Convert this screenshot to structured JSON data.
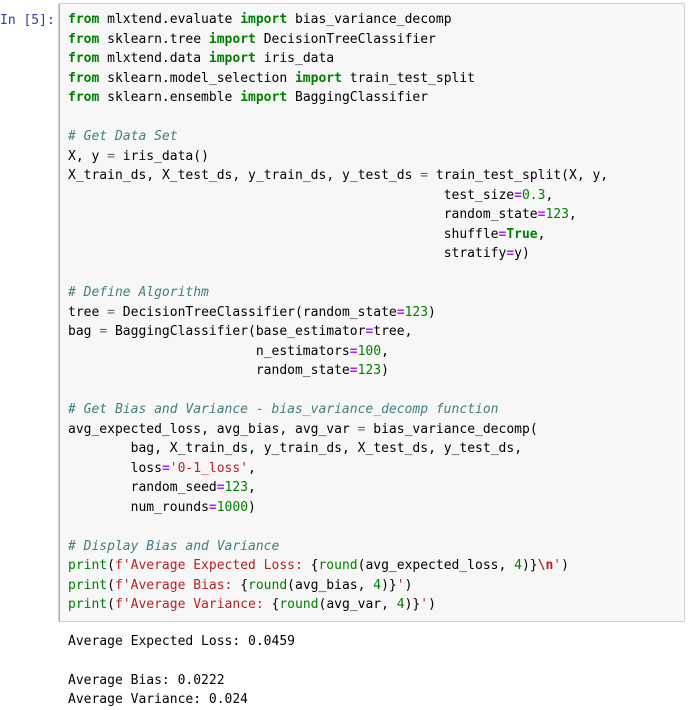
{
  "cell": {
    "prompt_label": "In [5]:",
    "language": "python",
    "colors": {
      "keyword": "#008000",
      "comment": "#408080",
      "string": "#ba2121",
      "number": "#008000",
      "operator": "#666666",
      "kwarg_equals": "#aa22ff",
      "prompt": "#303f9f",
      "code_background": "#f7f7f7",
      "code_border": "#cfcfcf"
    },
    "source_lines": [
      "from mlxtend.evaluate import bias_variance_decomp",
      "from sklearn.tree import DecisionTreeClassifier",
      "from mlxtend.data import iris_data",
      "from sklearn.model_selection import train_test_split",
      "from sklearn.ensemble import BaggingClassifier",
      "",
      "# Get Data Set",
      "X, y = iris_data()",
      "X_train_ds, X_test_ds, y_train_ds, y_test_ds = train_test_split(X, y,",
      "                                                test_size=0.3,",
      "                                                random_state=123,",
      "                                                shuffle=True,",
      "                                                stratify=y)",
      "",
      "# Define Algorithm",
      "tree = DecisionTreeClassifier(random_state=123)",
      "bag = BaggingClassifier(base_estimator=tree,",
      "                        n_estimators=100,",
      "                        random_state=123)",
      "",
      "# Get Bias and Variance - bias_variance_decomp function",
      "avg_expected_loss, avg_bias, avg_var = bias_variance_decomp(",
      "        bag, X_train_ds, y_train_ds, X_test_ds, y_test_ds,",
      "        loss='0-1_loss',",
      "        random_seed=123,",
      "        num_rounds=1000)",
      "",
      "# Display Bias and Variance",
      "print(f'Average Expected Loss: {round(avg_expected_loss, 4)}\\n')",
      "print(f'Average Bias: {round(avg_bias, 4)}')",
      "print(f'Average Variance: {round(avg_var, 4)}')"
    ]
  },
  "output": {
    "text": "Average Expected Loss: 0.0459\n\nAverage Bias: 0.0222\nAverage Variance: 0.024",
    "lines": [
      "Average Expected Loss: 0.0459",
      "",
      "Average Bias: 0.0222",
      "Average Variance: 0.024"
    ],
    "values": {
      "average_expected_loss": "0.0459",
      "average_bias": "0.0222",
      "average_variance": "0.024"
    }
  }
}
